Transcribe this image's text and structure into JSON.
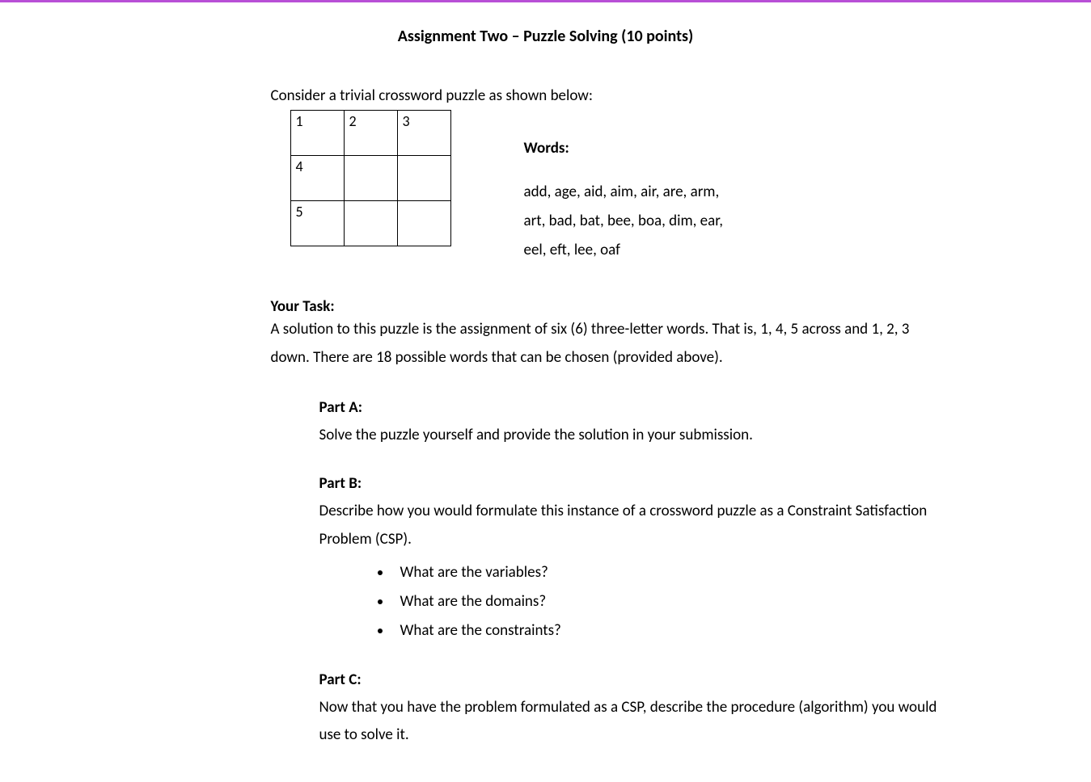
{
  "title": "Assignment Two – Puzzle Solving (10 points)",
  "intro": "Consider a trivial crossword puzzle as shown below:",
  "grid": {
    "rows": [
      [
        "1",
        "2",
        "3"
      ],
      [
        "4",
        "",
        ""
      ],
      [
        "5",
        "",
        ""
      ]
    ]
  },
  "words": {
    "heading": "Words:",
    "line1": "add, age, aid, aim, air, are, arm,",
    "line2": "art, bad, bat, bee, boa, dim, ear,",
    "line3": "eel, eft, lee, oaf"
  },
  "task": {
    "heading": "Your Task:",
    "desc": "A solution to this puzzle is the assignment of six (6) three-letter words.  That is, 1, 4, 5 across and 1, 2, 3 down.  There are 18 possible words that can be chosen (provided above)."
  },
  "partA": {
    "heading": "Part A:",
    "body": "Solve the puzzle yourself and provide the solution in your submission."
  },
  "partB": {
    "heading": "Part B:",
    "body": "Describe how you would formulate this instance of a crossword puzzle as a Constraint Satisfaction Problem (CSP).",
    "bullets": [
      "What are the variables?",
      "What are the domains?",
      "What are the constraints?"
    ]
  },
  "partC": {
    "heading": "Part C:",
    "body": "Now that you have the problem formulated as a CSP, describe the procedure (algorithm) you would use to solve it."
  }
}
